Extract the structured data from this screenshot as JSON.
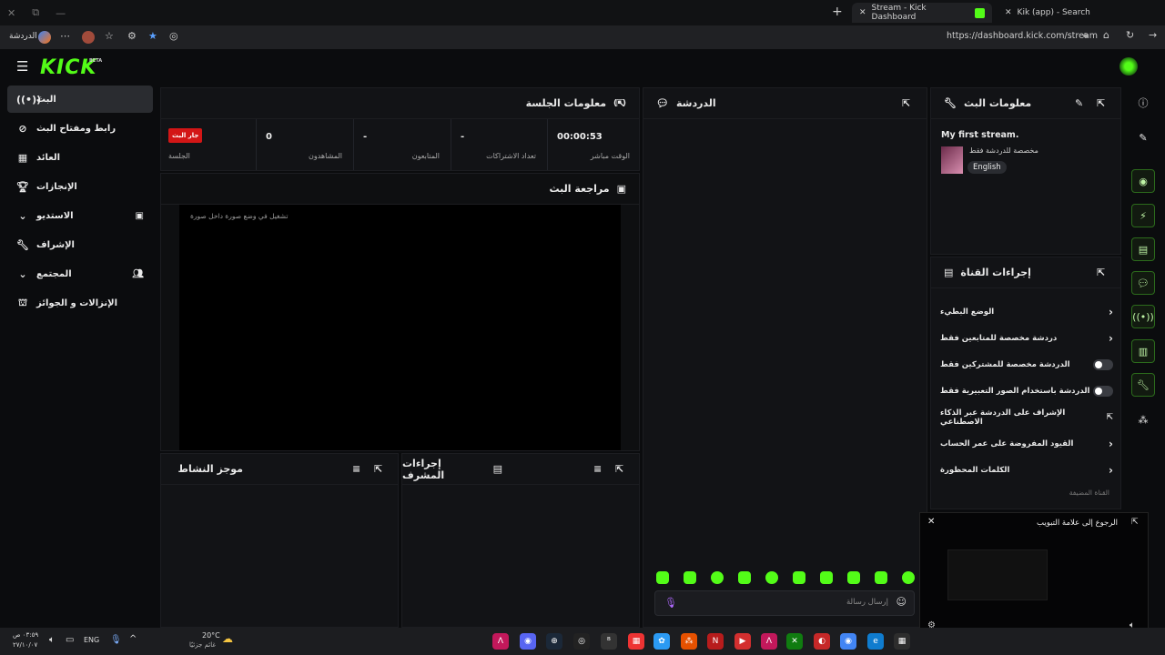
{
  "browser": {
    "window_controls": [
      "✕",
      "⧉",
      "—"
    ],
    "tabs": [
      {
        "label": "Stream - Kick Dashboard",
        "active": true
      },
      {
        "label": "Kik (app) - Search",
        "active": false
      }
    ],
    "address": "https://dashboard.kick.com/stream",
    "profile_label": "الدردشة",
    "new_tab": "+"
  },
  "app": {
    "logo": "KICK",
    "logo_badge": "BETA"
  },
  "sidebar": {
    "items": [
      {
        "label": "البث",
        "icon": "live-icon"
      },
      {
        "label": "رابط ومفتاح البث",
        "icon": "link-icon"
      },
      {
        "label": "العائد",
        "icon": "chart-icon"
      },
      {
        "label": "الإنجازات",
        "icon": "trophy-icon"
      },
      {
        "label": "الاستديو",
        "icon": "studio-icon"
      },
      {
        "label": "الإشراف",
        "icon": "wrench-icon"
      },
      {
        "label": "المجتمع",
        "icon": "community-icon"
      },
      {
        "label": "الإنزالات و الجوائز",
        "icon": "drops-icon"
      }
    ]
  },
  "session": {
    "title": "معلومات الجلسة",
    "badge": "جار البث",
    "session_label": "الجلسة",
    "stats": [
      {
        "value": "0",
        "label": "المشاهدون"
      },
      {
        "value": "-",
        "label": "المتابعون"
      },
      {
        "value": "-",
        "label": "تعداد الاشتراكات"
      },
      {
        "value": "00:00:53",
        "label": "الوقت مباشر"
      }
    ]
  },
  "preview": {
    "title": "مراجعة البث",
    "note": "تشغيل في وضع صورة داخل صورة"
  },
  "activity": {
    "title": "موجز النشاط"
  },
  "mod_actions": {
    "title": "إجراءات المشرف"
  },
  "chat": {
    "title": "الدردشة",
    "placeholder": "إرسال رسالة"
  },
  "stream_info": {
    "title": "معلومات البث",
    "stream_title": "My first stream.",
    "subtitle": "مخصصة للدردشة فقط",
    "language": "English"
  },
  "channel_actions": {
    "title": "إجراءات القناة",
    "rows": [
      {
        "label": "الوضع البطيء",
        "kind": "chevron"
      },
      {
        "label": "دردشة مخصصة للمتابعين فقط",
        "kind": "chevron"
      },
      {
        "label": "الدردشة مخصصة للمشتركين فقط",
        "kind": "toggle"
      },
      {
        "label": "الدردشة باستخدام الصور التعبيرية فقط",
        "kind": "toggle"
      },
      {
        "label": "الإشراف على الدردشة عبر الذكاء الاصطناعي",
        "kind": "external"
      },
      {
        "label": "القيود المفروضة على عمر الحساب",
        "kind": "chevron"
      },
      {
        "label": "الكلمات المحظورة",
        "kind": "chevron"
      }
    ],
    "footer": "القناة المضيفة"
  },
  "pip": {
    "back_label": "الرجوع إلى علامة التبويب"
  },
  "taskbar": {
    "weather": "20°C",
    "weather_sub": "غائم جزئيًا",
    "lang": "ENG",
    "time": "٠٣:٥٩ ص",
    "date": "٢٧/١٠/٠٧"
  },
  "colors": {
    "brand": "#53fc18",
    "live": "#d31616",
    "panel": "#121316"
  }
}
